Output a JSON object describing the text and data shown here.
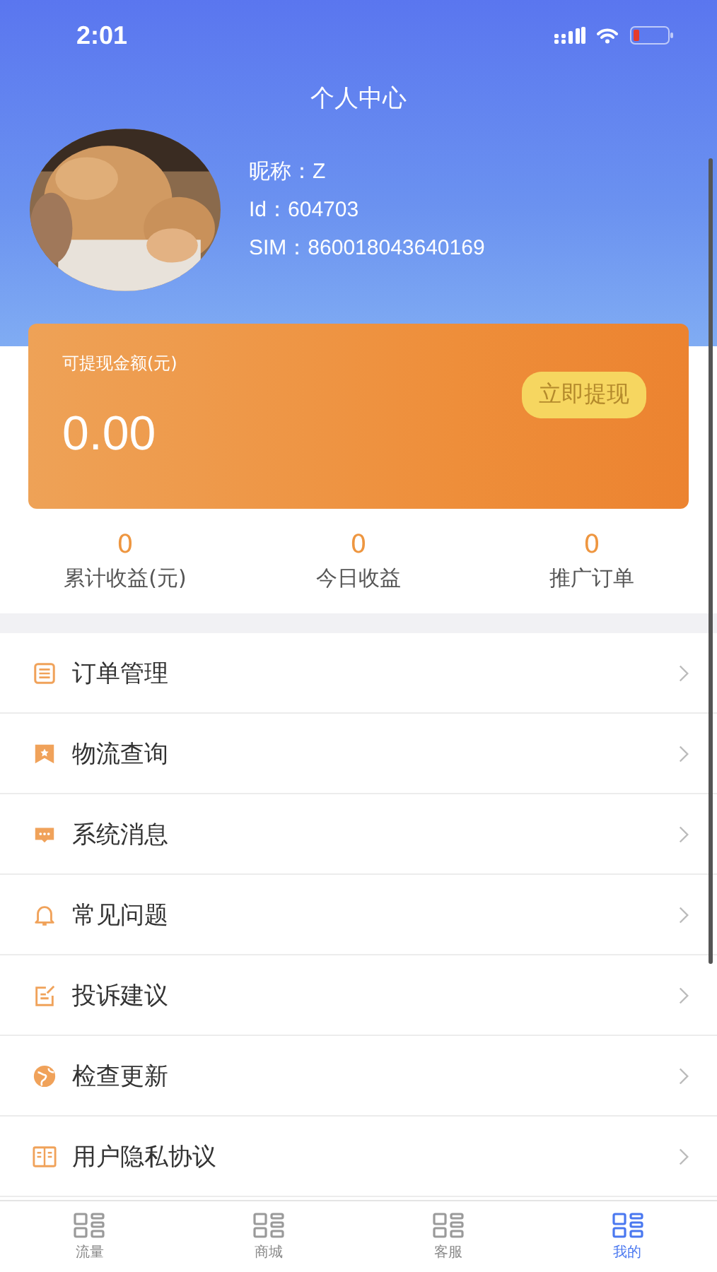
{
  "status_bar": {
    "time": "2:01",
    "battery_low": true
  },
  "header": {
    "title": "个人中心",
    "profile": [
      {
        "label": "昵称：",
        "value": "Z"
      },
      {
        "label": "Id：",
        "value": "604703"
      },
      {
        "label": "SIM：",
        "value": "860018043640169"
      }
    ]
  },
  "balance_card": {
    "label": "可提现金额(元)",
    "amount": "0.00",
    "button": "立即提现"
  },
  "stats": [
    {
      "value": "0",
      "label": "累计收益(元)"
    },
    {
      "value": "0",
      "label": "今日收益"
    },
    {
      "value": "0",
      "label": "推广订单"
    }
  ],
  "menu": [
    {
      "label": "订单管理"
    },
    {
      "label": "物流查询"
    },
    {
      "label": "系统消息"
    },
    {
      "label": "常见问题"
    },
    {
      "label": "投诉建议"
    },
    {
      "label": "检查更新"
    },
    {
      "label": "用户隐私协议"
    }
  ],
  "tab_bar": [
    {
      "label": "流量",
      "selected": false
    },
    {
      "label": "商城",
      "selected": false
    },
    {
      "label": "客服",
      "selected": false
    },
    {
      "label": "我的",
      "selected": true
    }
  ]
}
